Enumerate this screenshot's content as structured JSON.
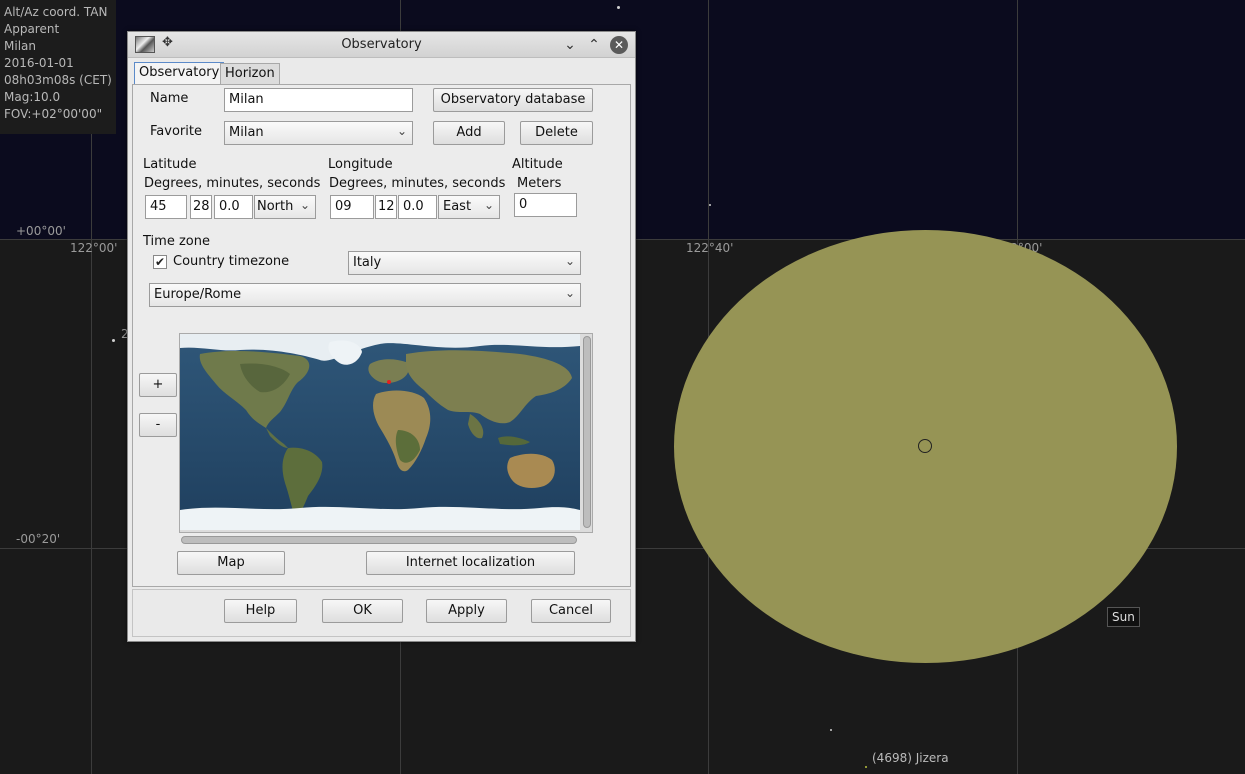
{
  "sky": {
    "info_lines": [
      "Alt/Az coord. TAN",
      "Apparent",
      "Milan",
      "2016-01-01",
      "08h03m08s (CET)",
      "Mag:10.0",
      "FOV:+02°00'00\""
    ],
    "labels": {
      "alt_00": "+00°00'",
      "alt_20": "-00°20'",
      "az_122_00": "122°00'",
      "az_122_40": "122°40'",
      "az_123_00": "123°00'",
      "left_partial": "2"
    },
    "sun_label": "Sun",
    "asteroid_label": "(4698) Jizera",
    "colors": {
      "sun": "#969455",
      "sky": "#0b0b1e",
      "ground": "#1a1a1a"
    }
  },
  "dialog": {
    "title": "Observatory",
    "titlebar_icons": [
      "app-icon",
      "pin-icon",
      "minimize-icon",
      "maximize-icon",
      "close-icon"
    ],
    "tabs": [
      {
        "label": "Observatory",
        "active": true
      },
      {
        "label": "Horizon",
        "active": false
      }
    ],
    "name": {
      "label": "Name",
      "value": "Milan"
    },
    "database_button": "Observatory database",
    "favorite": {
      "label": "Favorite",
      "value": "Milan"
    },
    "add_button": "Add",
    "delete_button": "Delete",
    "latitude": {
      "label": "Latitude",
      "sublabel": "Degrees, minutes, seconds",
      "deg": "45",
      "min": "28",
      "sec": "0.0",
      "hemisphere": "North"
    },
    "longitude": {
      "label": "Longitude",
      "sublabel": "Degrees, minutes, seconds",
      "deg": "09",
      "min": "12",
      "sec": "0.0",
      "hemisphere": "East"
    },
    "altitude": {
      "label": "Altitude",
      "sublabel": "Meters",
      "value": "0"
    },
    "timezone": {
      "label": "Time zone",
      "country_checkbox": "Country timezone",
      "country_checked": true,
      "country": "Italy",
      "zone": "Europe/Rome"
    },
    "zoom_in": "+",
    "zoom_out": "-",
    "map_button": "Map",
    "internet_button": "Internet localization",
    "help_button": "Help",
    "ok_button": "OK",
    "apply_button": "Apply",
    "cancel_button": "Cancel"
  }
}
